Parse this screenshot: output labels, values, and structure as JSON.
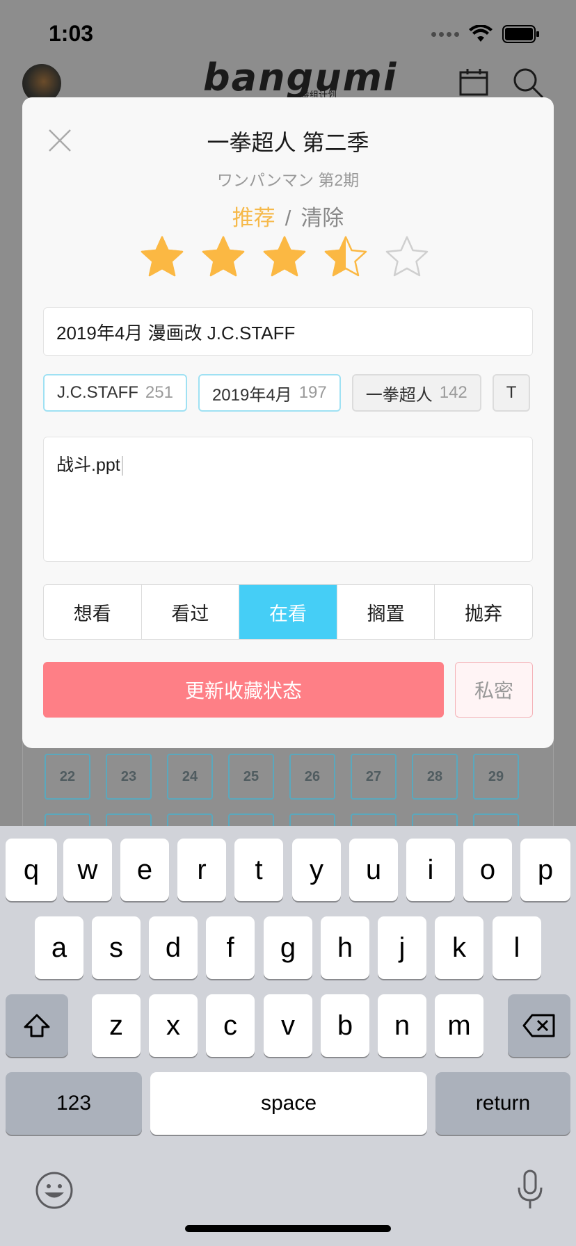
{
  "status_bar": {
    "time": "1:03"
  },
  "header": {
    "logo": "bangumi",
    "logo_sub": "番组计划"
  },
  "episodes": {
    "row1": [
      "22",
      "23",
      "24",
      "25",
      "26",
      "27",
      "28",
      "29"
    ]
  },
  "modal": {
    "title": "一拳超人 第二季",
    "subtitle": "ワンパンマン 第2期",
    "recommend_label": "推荐",
    "separator": "/",
    "clear_label": "清除",
    "rating": 3.5,
    "rating_max": 5,
    "tags_value": "2019年4月 漫画改 J.C.STAFF",
    "tag_chips": [
      {
        "name": "J.C.STAFF",
        "count": "251",
        "selected": true
      },
      {
        "name": "2019年4月",
        "count": "197",
        "selected": true
      },
      {
        "name": "一拳超人",
        "count": "142",
        "selected": false
      },
      {
        "name": "T",
        "count": "",
        "selected": false
      }
    ],
    "comment_value": "战斗.ppt",
    "status_options": [
      "想看",
      "看过",
      "在看",
      "搁置",
      "抛弃"
    ],
    "status_selected": "在看",
    "update_button": "更新收藏状态",
    "private_button": "私密"
  },
  "keyboard": {
    "row1": [
      "q",
      "w",
      "e",
      "r",
      "t",
      "y",
      "u",
      "i",
      "o",
      "p"
    ],
    "row2": [
      "a",
      "s",
      "d",
      "f",
      "g",
      "h",
      "j",
      "k",
      "l"
    ],
    "row3": [
      "z",
      "x",
      "c",
      "v",
      "b",
      "n",
      "m"
    ],
    "numbers_key": "123",
    "space_key": "space",
    "return_key": "return"
  },
  "colors": {
    "accent_blue": "#45cef6",
    "update_red": "#fe7f86",
    "star_gold": "#fbb843",
    "recommend_orange": "#f6b94a"
  }
}
